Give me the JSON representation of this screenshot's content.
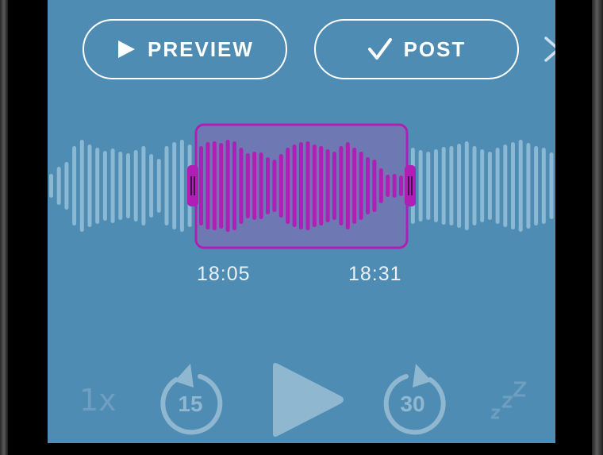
{
  "toolbar": {
    "preview_label": "PREVIEW",
    "post_label": "POST"
  },
  "selection": {
    "start_time": "18:05",
    "end_time": "18:31"
  },
  "player": {
    "speed_label": "1x",
    "skip_back_label": "15",
    "skip_forward_label": "30",
    "sleep_label": "zzz"
  },
  "colors": {
    "screen_background": "#4f8cb3",
    "waveform": "#8bb8d3",
    "selection_border": "#b01fb5",
    "selection_fill": "#6e78b2",
    "selection_bars": "#b01fb5",
    "control_faded": "#8fb7d0"
  },
  "icons": [
    "play-icon",
    "checkmark-icon",
    "chevron-right-icon",
    "skip-back-icon",
    "play-large-icon",
    "skip-forward-icon",
    "sleep-timer-icon"
  ]
}
